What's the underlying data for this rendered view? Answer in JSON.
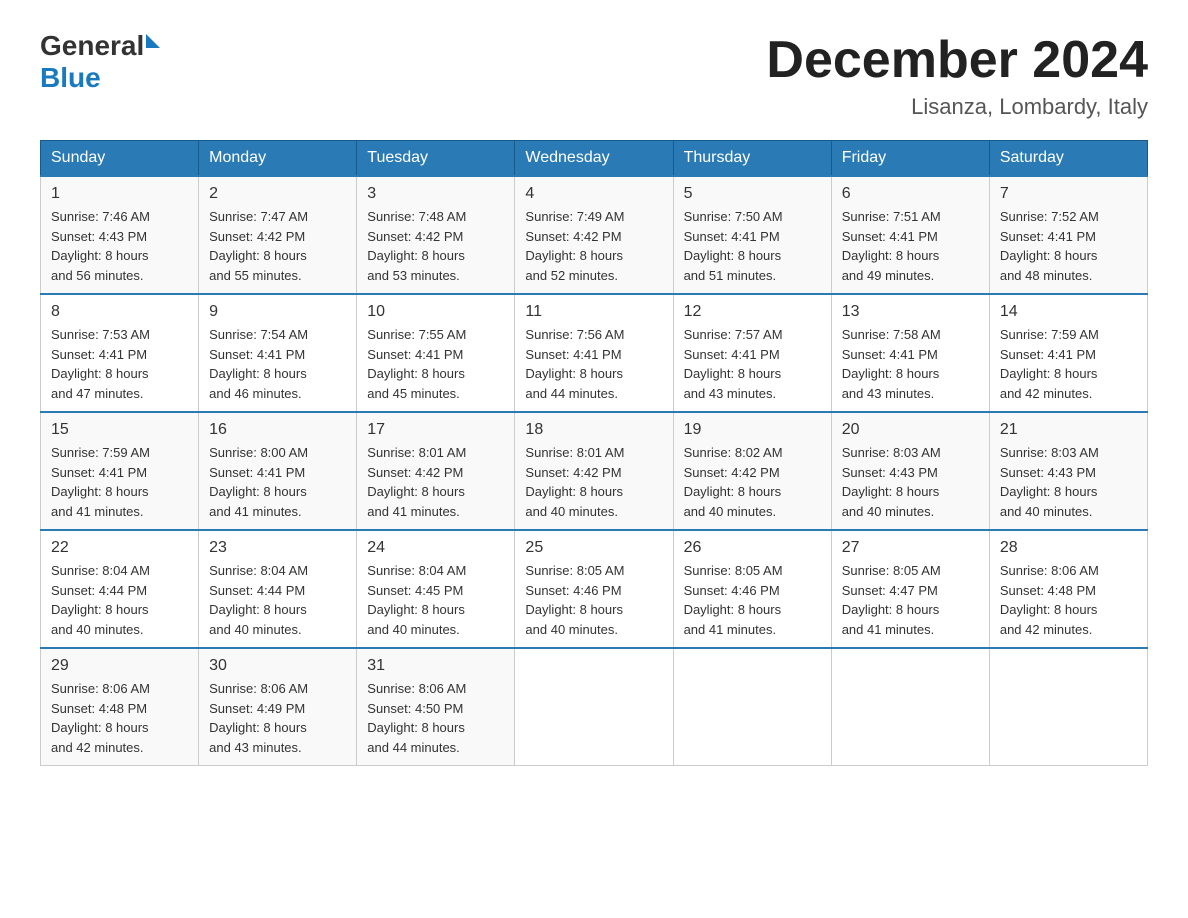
{
  "header": {
    "logo_general": "General",
    "logo_blue": "Blue",
    "month_title": "December 2024",
    "location": "Lisanza, Lombardy, Italy"
  },
  "weekdays": [
    "Sunday",
    "Monday",
    "Tuesday",
    "Wednesday",
    "Thursday",
    "Friday",
    "Saturday"
  ],
  "weeks": [
    [
      {
        "day": "1",
        "sunrise": "7:46 AM",
        "sunset": "4:43 PM",
        "daylight": "8 hours and 56 minutes."
      },
      {
        "day": "2",
        "sunrise": "7:47 AM",
        "sunset": "4:42 PM",
        "daylight": "8 hours and 55 minutes."
      },
      {
        "day": "3",
        "sunrise": "7:48 AM",
        "sunset": "4:42 PM",
        "daylight": "8 hours and 53 minutes."
      },
      {
        "day": "4",
        "sunrise": "7:49 AM",
        "sunset": "4:42 PM",
        "daylight": "8 hours and 52 minutes."
      },
      {
        "day": "5",
        "sunrise": "7:50 AM",
        "sunset": "4:41 PM",
        "daylight": "8 hours and 51 minutes."
      },
      {
        "day": "6",
        "sunrise": "7:51 AM",
        "sunset": "4:41 PM",
        "daylight": "8 hours and 49 minutes."
      },
      {
        "day": "7",
        "sunrise": "7:52 AM",
        "sunset": "4:41 PM",
        "daylight": "8 hours and 48 minutes."
      }
    ],
    [
      {
        "day": "8",
        "sunrise": "7:53 AM",
        "sunset": "4:41 PM",
        "daylight": "8 hours and 47 minutes."
      },
      {
        "day": "9",
        "sunrise": "7:54 AM",
        "sunset": "4:41 PM",
        "daylight": "8 hours and 46 minutes."
      },
      {
        "day": "10",
        "sunrise": "7:55 AM",
        "sunset": "4:41 PM",
        "daylight": "8 hours and 45 minutes."
      },
      {
        "day": "11",
        "sunrise": "7:56 AM",
        "sunset": "4:41 PM",
        "daylight": "8 hours and 44 minutes."
      },
      {
        "day": "12",
        "sunrise": "7:57 AM",
        "sunset": "4:41 PM",
        "daylight": "8 hours and 43 minutes."
      },
      {
        "day": "13",
        "sunrise": "7:58 AM",
        "sunset": "4:41 PM",
        "daylight": "8 hours and 43 minutes."
      },
      {
        "day": "14",
        "sunrise": "7:59 AM",
        "sunset": "4:41 PM",
        "daylight": "8 hours and 42 minutes."
      }
    ],
    [
      {
        "day": "15",
        "sunrise": "7:59 AM",
        "sunset": "4:41 PM",
        "daylight": "8 hours and 41 minutes."
      },
      {
        "day": "16",
        "sunrise": "8:00 AM",
        "sunset": "4:41 PM",
        "daylight": "8 hours and 41 minutes."
      },
      {
        "day": "17",
        "sunrise": "8:01 AM",
        "sunset": "4:42 PM",
        "daylight": "8 hours and 41 minutes."
      },
      {
        "day": "18",
        "sunrise": "8:01 AM",
        "sunset": "4:42 PM",
        "daylight": "8 hours and 40 minutes."
      },
      {
        "day": "19",
        "sunrise": "8:02 AM",
        "sunset": "4:42 PM",
        "daylight": "8 hours and 40 minutes."
      },
      {
        "day": "20",
        "sunrise": "8:03 AM",
        "sunset": "4:43 PM",
        "daylight": "8 hours and 40 minutes."
      },
      {
        "day": "21",
        "sunrise": "8:03 AM",
        "sunset": "4:43 PM",
        "daylight": "8 hours and 40 minutes."
      }
    ],
    [
      {
        "day": "22",
        "sunrise": "8:04 AM",
        "sunset": "4:44 PM",
        "daylight": "8 hours and 40 minutes."
      },
      {
        "day": "23",
        "sunrise": "8:04 AM",
        "sunset": "4:44 PM",
        "daylight": "8 hours and 40 minutes."
      },
      {
        "day": "24",
        "sunrise": "8:04 AM",
        "sunset": "4:45 PM",
        "daylight": "8 hours and 40 minutes."
      },
      {
        "day": "25",
        "sunrise": "8:05 AM",
        "sunset": "4:46 PM",
        "daylight": "8 hours and 40 minutes."
      },
      {
        "day": "26",
        "sunrise": "8:05 AM",
        "sunset": "4:46 PM",
        "daylight": "8 hours and 41 minutes."
      },
      {
        "day": "27",
        "sunrise": "8:05 AM",
        "sunset": "4:47 PM",
        "daylight": "8 hours and 41 minutes."
      },
      {
        "day": "28",
        "sunrise": "8:06 AM",
        "sunset": "4:48 PM",
        "daylight": "8 hours and 42 minutes."
      }
    ],
    [
      {
        "day": "29",
        "sunrise": "8:06 AM",
        "sunset": "4:48 PM",
        "daylight": "8 hours and 42 minutes."
      },
      {
        "day": "30",
        "sunrise": "8:06 AM",
        "sunset": "4:49 PM",
        "daylight": "8 hours and 43 minutes."
      },
      {
        "day": "31",
        "sunrise": "8:06 AM",
        "sunset": "4:50 PM",
        "daylight": "8 hours and 44 minutes."
      },
      null,
      null,
      null,
      null
    ]
  ],
  "labels": {
    "sunrise": "Sunrise:",
    "sunset": "Sunset:",
    "daylight": "Daylight:"
  }
}
